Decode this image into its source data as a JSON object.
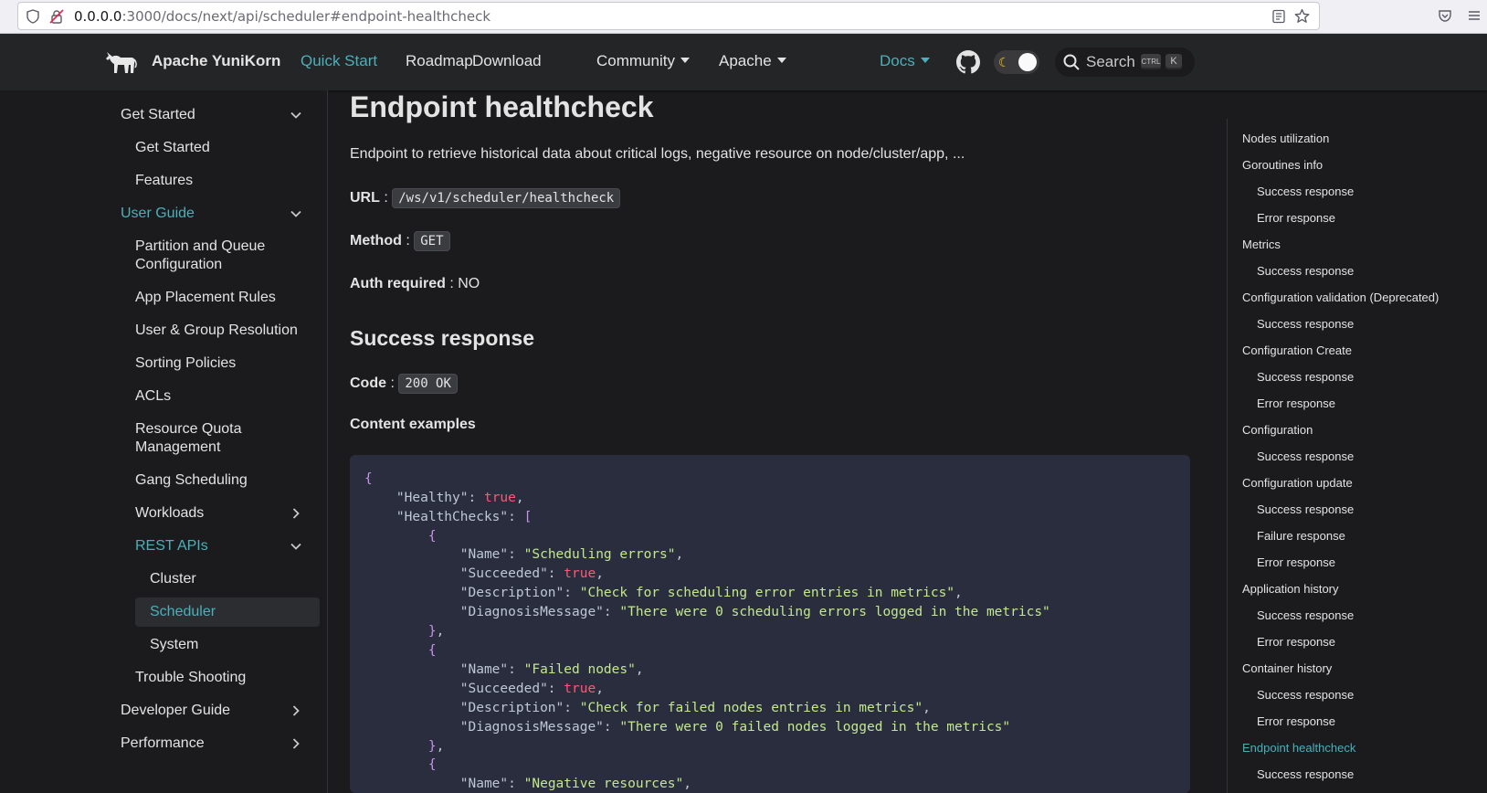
{
  "browser": {
    "url_host": "0.0.0.0",
    "url_rest": ":3000/docs/next/api/scheduler#endpoint-healthcheck"
  },
  "navbar": {
    "brand": "Apache YuniKorn",
    "links": [
      {
        "label": "Quick Start",
        "active": true
      },
      {
        "label": "Roadmap"
      },
      {
        "label": "Download"
      },
      {
        "label": "Community"
      },
      {
        "label": "Apache"
      },
      {
        "label": "Docs"
      }
    ],
    "search_label": "Search",
    "kbd_ctrl": "CTRL",
    "kbd_k": "K",
    "accent_color": "#4ab0bb"
  },
  "sidebar": {
    "items": [
      {
        "label": "Get Started"
      },
      {
        "label": "Get Started"
      },
      {
        "label": "Features"
      },
      {
        "label": "User Guide"
      },
      {
        "label": "Partition and Queue Configuration"
      },
      {
        "label": "App Placement Rules"
      },
      {
        "label": "User & Group Resolution"
      },
      {
        "label": "Sorting Policies"
      },
      {
        "label": "ACLs"
      },
      {
        "label": "Resource Quota Management"
      },
      {
        "label": "Gang Scheduling"
      },
      {
        "label": "Workloads"
      },
      {
        "label": "REST APIs"
      },
      {
        "label": "Cluster"
      },
      {
        "label": "Scheduler"
      },
      {
        "label": "System"
      },
      {
        "label": "Trouble Shooting"
      },
      {
        "label": "Developer Guide"
      },
      {
        "label": "Performance"
      }
    ]
  },
  "content": {
    "title": "Endpoint healthcheck",
    "description": "Endpoint to retrieve historical data about critical logs, negative resource on node/cluster/app, ...",
    "url_label": "URL",
    "url_value": "/ws/v1/scheduler/healthcheck",
    "method_label": "Method",
    "method_value": "GET",
    "auth_label": "Auth required",
    "auth_value": "NO",
    "success_heading": "Success response",
    "code_label": "Code",
    "code_value": "200 OK",
    "examples_heading": "Content examples",
    "separator": " : "
  },
  "code": {
    "healthy_key": "\"Healthy\"",
    "healthy_val": "true",
    "checks_key": "\"HealthChecks\"",
    "name_key": "\"Name\"",
    "succeeded_key": "\"Succeeded\"",
    "description_key": "\"Description\"",
    "diag_key": "\"DiagnosisMessage\"",
    "check1": {
      "name": "\"Scheduling errors\"",
      "succeeded": "true",
      "description": "\"Check for scheduling error entries in metrics\"",
      "diag": "\"There were 0 scheduling errors logged in the metrics\""
    },
    "check2": {
      "name": "\"Failed nodes\"",
      "succeeded": "true",
      "description": "\"Check for failed nodes entries in metrics\"",
      "diag": "\"There were 0 failed nodes logged in the metrics\""
    },
    "check3": {
      "name": "\"Negative resources\""
    }
  },
  "toc": {
    "items": [
      {
        "label": "Nodes utilization"
      },
      {
        "label": "Goroutines info"
      },
      {
        "label": "Success response"
      },
      {
        "label": "Error response"
      },
      {
        "label": "Metrics"
      },
      {
        "label": "Success response"
      },
      {
        "label": "Configuration validation (Deprecated)"
      },
      {
        "label": "Success response"
      },
      {
        "label": "Configuration Create"
      },
      {
        "label": "Success response"
      },
      {
        "label": "Error response"
      },
      {
        "label": "Configuration"
      },
      {
        "label": "Success response"
      },
      {
        "label": "Configuration update"
      },
      {
        "label": "Success response"
      },
      {
        "label": "Failure response"
      },
      {
        "label": "Error response"
      },
      {
        "label": "Application history"
      },
      {
        "label": "Success response"
      },
      {
        "label": "Error response"
      },
      {
        "label": "Container history"
      },
      {
        "label": "Success response"
      },
      {
        "label": "Error response"
      },
      {
        "label": "Endpoint healthcheck"
      },
      {
        "label": "Success response"
      }
    ]
  }
}
